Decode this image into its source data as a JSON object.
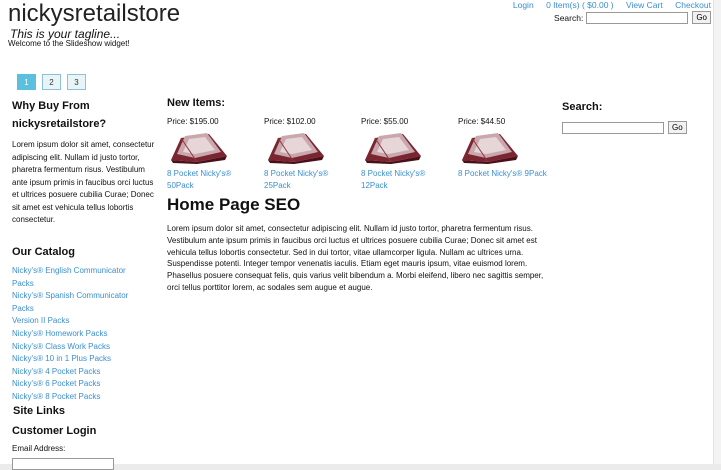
{
  "header": {
    "site_title": "nickysretailstore",
    "tagline": "This is your tagline...",
    "welcome": "Welcome to the Slideshow widget!"
  },
  "top_links": {
    "login": "Login",
    "cart_count": "0 Item(s)",
    "cart_total": "( $0.00 )",
    "view_cart": "View Cart",
    "checkout": "Checkout"
  },
  "top_search": {
    "label": "Search:",
    "button": "Go",
    "value": ""
  },
  "slideshow": {
    "pages": [
      "1",
      "2",
      "3"
    ],
    "active": "1"
  },
  "why_buy": {
    "heading_line1": "Why Buy From",
    "heading_line2": "nickysretailstore?",
    "text": "Lorem ipsum dolor sit amet, consectetur adipiscing elit. Nullam id justo tortor, pharetra fermentum risus. Vestibulum ante ipsum primis in faucibus orci luctus et ultrices posuere cubilia Curae; Donec sit amet est vehicula tellus lobortis consectetur."
  },
  "catalog": {
    "heading": "Our Catalog",
    "items": [
      "Nicky's® English Communicator",
      "Packs",
      "Nicky's® Spanish Communicator",
      "Packs",
      "Version II Packs",
      "Nicky's® Homework Packs",
      "Nicky's® Class Work Packs",
      "Nicky's® 10 in 1 Plus Packs",
      "Nicky's® 4 Pocket Packs",
      "Nicky's® 6 Pocket Packs",
      "Nicky's® 8 Pocket Packs"
    ]
  },
  "site_links": {
    "heading": "Site Links"
  },
  "customer_login": {
    "heading": "Customer Login",
    "email_label": "Email Address:"
  },
  "new_items": {
    "heading": "New Items:",
    "products": [
      {
        "price": "Price: $195.00",
        "name_line1": "8 Pocket Nicky's®",
        "name_line2": "50Pack"
      },
      {
        "price": "Price: $102.00",
        "name_line1": "8 Pocket Nicky's®",
        "name_line2": "25Pack"
      },
      {
        "price": "Price: $55.00",
        "name_line1": "8 Pocket Nicky's®",
        "name_line2": "12Pack"
      },
      {
        "price": "Price: $44.50",
        "name_line1": "8 Pocket Nicky's® 9Pack",
        "name_line2": ""
      }
    ]
  },
  "seo": {
    "heading": "Home Page SEO",
    "text": "Lorem ipsum dolor sit amet, consectetur adipiscing elit. Nullam id justo tortor, pharetra fermentum risus. Vestibulum ante ipsum primis in faucibus orci luctus et ultrices posuere cubilia Curae; Donec sit amet est vehicula tellus lobortis consectetur. Sed in dui tortor, vitae ullamcorper ligula. Nullam ac ultrices urna. Suspendisse potenti. Integer tempor venenatis iaculis. Etiam eget mauris ipsum, vitae euismod lorem. Phasellus posuere consequat felis, quis varius velit bibendum a. Morbi eleifend, libero nec sagittis semper, orci tellus porttitor lorem, ac sodales sem augue et augue."
  },
  "right_search": {
    "heading": "Search:",
    "button": "Go",
    "value": ""
  },
  "colors": {
    "link": "#3a8fd0",
    "pager_active": "#5bc0de"
  },
  "icons": {
    "product_image": "folder-pack-image"
  }
}
